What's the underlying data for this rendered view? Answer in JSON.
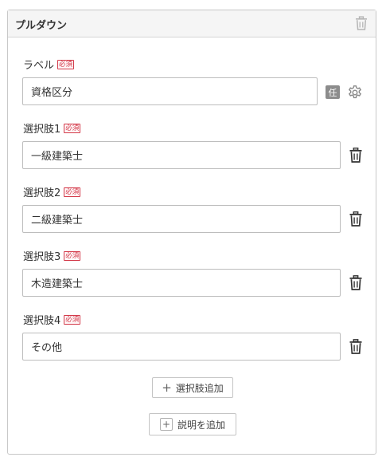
{
  "panel": {
    "title": "プルダウン",
    "label_field": {
      "label": "ラベル",
      "required_badge": "必須",
      "value": "資格区分",
      "optional_badge": "任",
      "settings_icon": "gear-icon"
    },
    "options": [
      {
        "label": "選択肢1",
        "required_badge": "必須",
        "value": "一級建築士"
      },
      {
        "label": "選択肢2",
        "required_badge": "必須",
        "value": "二級建築士"
      },
      {
        "label": "選択肢3",
        "required_badge": "必須",
        "value": "木造建築士"
      },
      {
        "label": "選択肢4",
        "required_badge": "必須",
        "value": "その他"
      }
    ],
    "add_option_button": {
      "icon": "+",
      "label": "選択肢追加"
    },
    "add_description_button": {
      "icon": "+",
      "label": "説明を追加"
    }
  },
  "colors": {
    "required": "#d33a4a",
    "border": "#bdbdbd",
    "header_bg": "#f5f5f5",
    "badge_gray": "#8c8c8c"
  }
}
